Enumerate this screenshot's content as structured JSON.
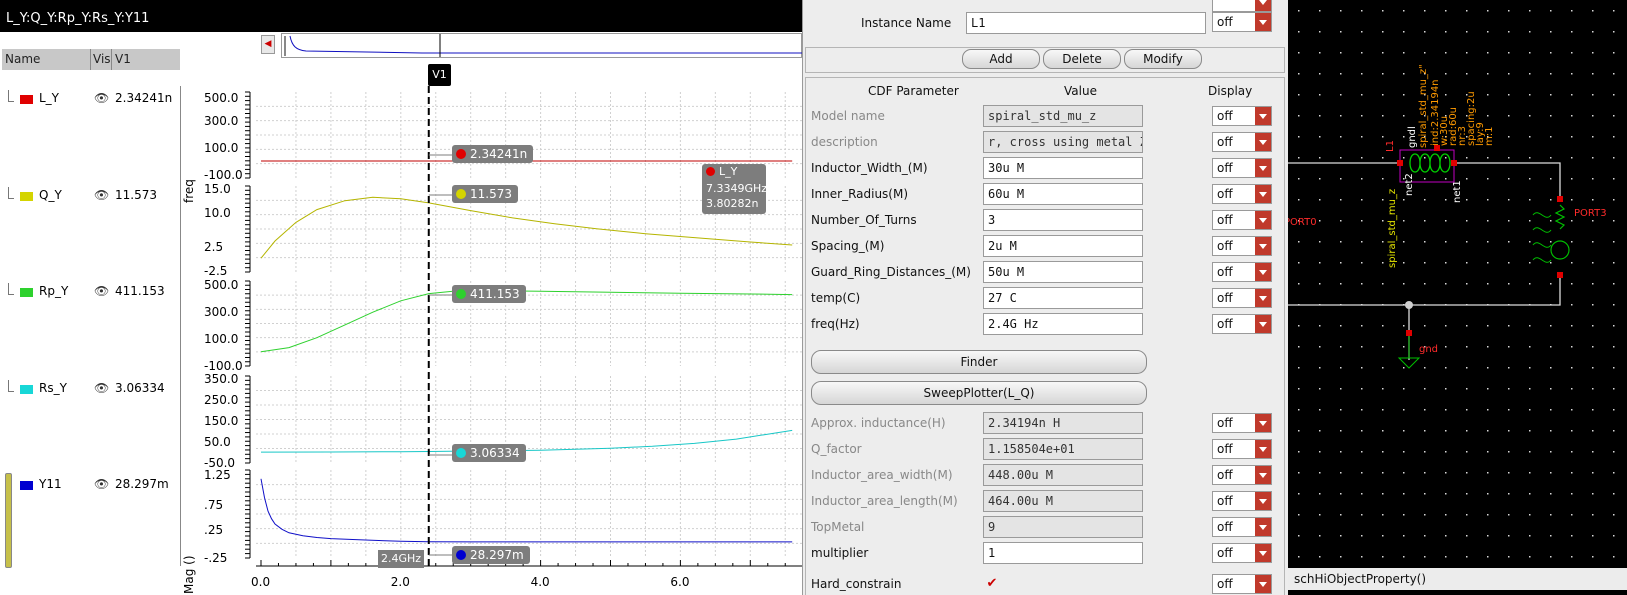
{
  "waveform": {
    "title": "L_Y:Q_Y:Rp_Y:Rs_Y:Y11",
    "headers": {
      "name": "Name",
      "vis": "Vis",
      "v1": "V1"
    },
    "signals": [
      {
        "name": "L_Y",
        "value": "2.34241n",
        "color": "#e00000"
      },
      {
        "name": "Q_Y",
        "value": "11.573",
        "color": "#d4d400"
      },
      {
        "name": "Rp_Y",
        "value": "411.153",
        "color": "#2ed12e"
      },
      {
        "name": "Rs_Y",
        "value": "3.06334",
        "color": "#18d7d7"
      },
      {
        "name": "Y11",
        "value": "28.297m",
        "color": "#0000d0"
      }
    ],
    "cursor": {
      "label": "V1",
      "x_value": 2.4,
      "x_label": "2.4GHz"
    },
    "markers": [
      "2.34241n",
      "11.573",
      "411.153",
      "3.06334",
      "28.297m"
    ],
    "point_marker": {
      "name": "L_Y",
      "freq": "7.3349GHz",
      "value": "3.80282n"
    },
    "axis_titles": {
      "freq": "freq",
      "mag": "Mag ()"
    },
    "x_ticks": [
      "0.0",
      "2.0",
      "4.0",
      "6.0"
    ]
  },
  "chart_data": [
    {
      "type": "line",
      "series": [
        {
          "name": "L_Y",
          "x": [
            0.0,
            2.4,
            7.6
          ],
          "y": [
            2.34241e-09,
            2.34241e-09,
            2.34241e-09
          ]
        }
      ],
      "y_ticks": [
        "500.0",
        "300.0",
        "100.0",
        "-100.0"
      ],
      "ylabel": "freq",
      "xlim": [
        0.0,
        7.7
      ]
    },
    {
      "type": "line",
      "series": [
        {
          "name": "Q_Y",
          "x": [
            0.0,
            0.2,
            0.5,
            0.8,
            1.2,
            1.6,
            2.0,
            2.4,
            3.0,
            3.6,
            4.2,
            4.8,
            5.5,
            6.2,
            7.0,
            7.6
          ],
          "y": [
            0.3,
            3.8,
            7.6,
            10.2,
            12.0,
            12.7,
            12.4,
            11.57,
            10.0,
            8.5,
            7.3,
            6.3,
            5.3,
            4.5,
            3.6,
            3.0
          ]
        }
      ],
      "y_ticks": [
        "15.0",
        "10.0",
        "2.5",
        "-2.5"
      ],
      "ylim": [
        -2.5,
        15.0
      ]
    },
    {
      "type": "line",
      "series": [
        {
          "name": "Rp_Y",
          "x": [
            0.0,
            0.4,
            0.8,
            1.2,
            1.6,
            2.0,
            2.4,
            2.8,
            3.2,
            4.0,
            5.0,
            6.0,
            7.0,
            7.6
          ],
          "y": [
            0,
            30,
            100,
            190,
            280,
            360,
            411,
            430,
            432,
            428,
            420,
            414,
            408,
            404
          ]
        }
      ],
      "y_ticks": [
        "500.0",
        "300.0",
        "100.0",
        "-100.0"
      ],
      "ylim": [
        -100,
        500
      ]
    },
    {
      "type": "line",
      "series": [
        {
          "name": "Rs_Y",
          "x": [
            0.0,
            1.0,
            2.0,
            2.4,
            3.0,
            4.0,
            5.0,
            5.6,
            6.2,
            6.8,
            7.2,
            7.6
          ],
          "y": [
            0,
            0.5,
            2.0,
            3.06,
            5,
            9,
            18,
            27,
            40,
            60,
            80,
            100
          ]
        }
      ],
      "y_ticks": [
        "350.0",
        "250.0",
        "150.0",
        "50.0",
        "-50.0"
      ],
      "ylim": [
        -50,
        350
      ]
    },
    {
      "type": "line",
      "series": [
        {
          "name": "Y11",
          "x": [
            0.0,
            0.05,
            0.1,
            0.15,
            0.2,
            0.3,
            0.4,
            0.6,
            0.8,
            1.0,
            1.4,
            2.0,
            2.4,
            3.0,
            4.0,
            5.0,
            6.0,
            7.0,
            7.6
          ],
          "y": [
            1.1,
            0.78,
            0.55,
            0.42,
            0.33,
            0.24,
            0.18,
            0.13,
            0.1,
            0.08,
            0.06,
            0.035,
            0.028,
            0.025,
            0.024,
            0.024,
            0.024,
            0.024,
            0.024
          ]
        }
      ],
      "y_ticks": [
        "1.25",
        ".75",
        ".25",
        "-.25"
      ],
      "ylabel": "Mag ()",
      "ylim": [
        -0.25,
        1.25
      ]
    }
  ],
  "form": {
    "instance_label": "Instance Name",
    "instance_value": "L1",
    "instance_display": "off",
    "buttons": {
      "add": "Add",
      "delete": "Delete",
      "modify": "Modify"
    },
    "cols": {
      "param": "CDF Parameter",
      "value": "Value",
      "display": "Display"
    },
    "params": [
      {
        "label": "Model name",
        "value": "spiral_std_mu_z",
        "display": "off",
        "editable": false
      },
      {
        "label": "description",
        "value": "r, cross using metal Z)",
        "display": "off",
        "editable": false
      },
      {
        "label": "Inductor_Width_(M)",
        "value": "30u M",
        "display": "off",
        "editable": true
      },
      {
        "label": "Inner_Radius(M)",
        "value": "60u M",
        "display": "off",
        "editable": true
      },
      {
        "label": "Number_Of_Turns",
        "value": "3",
        "display": "off",
        "editable": true
      },
      {
        "label": "Spacing_(M)",
        "value": "2u M",
        "display": "off",
        "editable": true
      },
      {
        "label": "Guard_Ring_Distances_(M)",
        "value": "50u M",
        "display": "off",
        "editable": true
      },
      {
        "label": "temp(C)",
        "value": "27 C",
        "display": "off",
        "editable": true
      },
      {
        "label": "freq(Hz)",
        "value": "2.4G Hz",
        "display": "off",
        "editable": true
      }
    ],
    "finder": "Finder",
    "sweep": "SweepPlotter(L_Q)",
    "params2": [
      {
        "label": "Approx. inductance(H)",
        "value": "2.34194n H",
        "display": "off",
        "editable": false
      },
      {
        "label": "Q_factor",
        "value": "1.158504e+01",
        "display": "off",
        "editable": false
      },
      {
        "label": "Inductor_area_width(M)",
        "value": "448.00u M",
        "display": "off",
        "editable": false
      },
      {
        "label": "Inductor_area_length(M)",
        "value": "464.00u M",
        "display": "off",
        "editable": false
      },
      {
        "label": "TopMetal",
        "value": "9",
        "display": "off",
        "editable": false
      },
      {
        "label": "multiplier",
        "value": "1",
        "display": "off",
        "editable": true
      }
    ],
    "hard_label": "Hard_constrain",
    "hard_display": "off"
  },
  "schematic": {
    "port0": "PORT0",
    "port3": "PORT3",
    "gnd": "gnd",
    "inst": "L1",
    "model_vert": "spiral_std_mu_z",
    "model_top": "spiral_std_mu_z\"",
    "net2": "net2",
    "net1": "net1",
    "gndl": "gndl",
    "params": [
      "ind:2.34194n",
      "w:30u",
      "rad:60u",
      "nr:3",
      "spacing:2u",
      "lay:9",
      "m:1"
    ],
    "status": "schHiObjectProperty()"
  }
}
